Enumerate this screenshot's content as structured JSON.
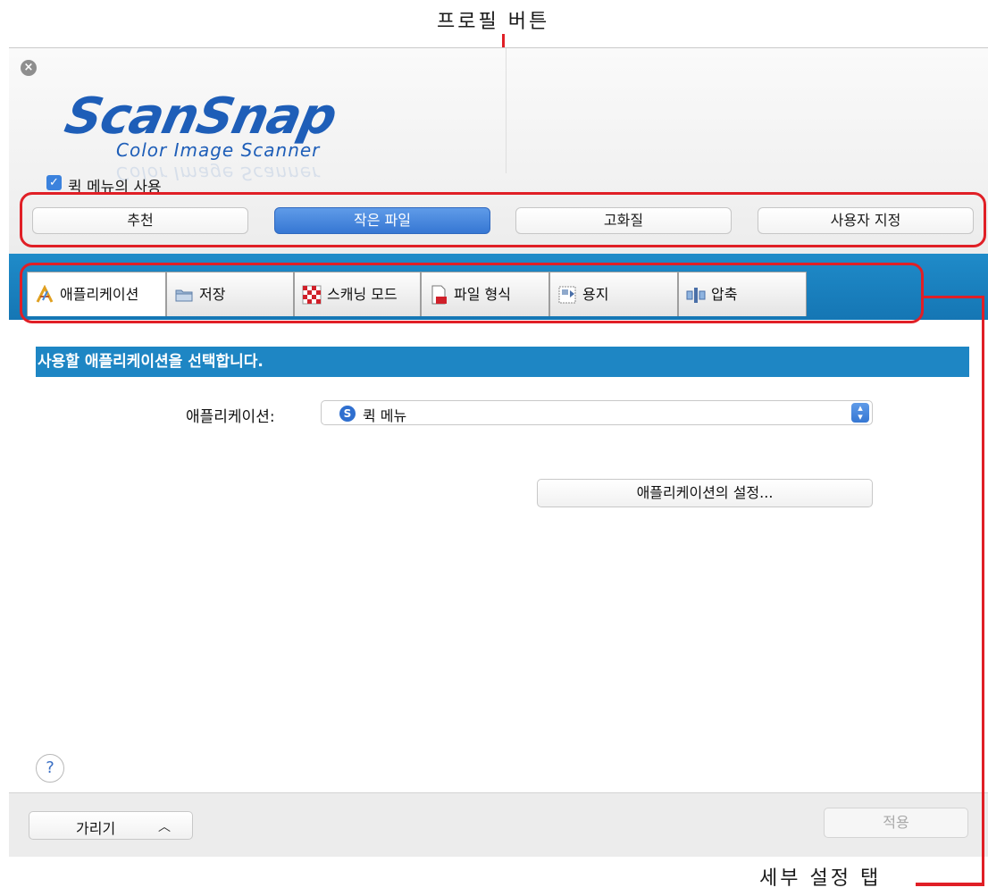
{
  "annotations": {
    "profile_buttons": "프로필 버튼",
    "detail_tabs": "세부 설정 탭"
  },
  "window": {
    "close_glyph": "×",
    "logo": {
      "main": "ScanSnap",
      "sub": "Color Image Scanner"
    },
    "quick_menu": {
      "label": "퀵 메뉴의 사용",
      "checked": true
    },
    "profiles": [
      {
        "label": "추천",
        "selected": false
      },
      {
        "label": "작은 파일",
        "selected": true
      },
      {
        "label": "고화질",
        "selected": false
      },
      {
        "label": "사용자 지정",
        "selected": false
      }
    ],
    "tabs": [
      {
        "label": "애플리케이션",
        "icon": "application-icon",
        "selected": true
      },
      {
        "label": "저장",
        "icon": "folder-icon",
        "selected": false
      },
      {
        "label": "스캐닝 모드",
        "icon": "scanning-mode-icon",
        "selected": false
      },
      {
        "label": "파일 형식",
        "icon": "file-format-icon",
        "selected": false
      },
      {
        "label": "용지",
        "icon": "paper-icon",
        "selected": false
      },
      {
        "label": "압축",
        "icon": "compression-icon",
        "selected": false
      }
    ],
    "content": {
      "header": "사용할 애플리케이션을 선택합니다.",
      "app_label": "애플리케이션:",
      "app_value": "퀵 메뉴",
      "settings_button": "애플리케이션의 설정...",
      "help": "?"
    },
    "footer": {
      "hide_label": "가리기",
      "hide_chevron": "︿",
      "apply_label": "적용"
    },
    "colors": {
      "accent": "#1e86c4",
      "selected_button": "#3677d3",
      "annotation_red": "#e01f26"
    }
  }
}
